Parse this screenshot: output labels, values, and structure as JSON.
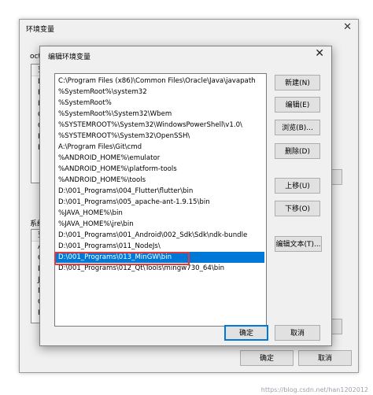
{
  "outer": {
    "title": "环境变量",
    "close": "✕",
    "user_section_label": "octo",
    "user_header": "变",
    "user_rows": [
      "De",
      "FL",
      "In",
      "O",
      "O",
      "Pa",
      "PU"
    ],
    "system_section_label": "系统",
    "system_header": "变",
    "system_rows": [
      "AI",
      "Cc",
      "Dr",
      "JA",
      "NI",
      "O",
      "Pa"
    ],
    "ok": "确定",
    "cancel": "取消"
  },
  "dialog": {
    "title": "编辑环境变量",
    "close": "✕",
    "paths": [
      "C:\\Program Files (x86)\\Common Files\\Oracle\\Java\\javapath",
      "%SystemRoot%\\system32",
      "%SystemRoot%",
      "%SystemRoot%\\System32\\Wbem",
      "%SYSTEMROOT%\\System32\\WindowsPowerShell\\v1.0\\",
      "%SYSTEMROOT%\\System32\\OpenSSH\\",
      "A:\\Program Files\\Git\\cmd",
      "%ANDROID_HOME%\\emulator",
      "%ANDROID_HOME%\\platform-tools",
      "%ANDROID_HOME%\\tools",
      "D:\\001_Programs\\004_Flutter\\flutter\\bin",
      "D:\\001_Programs\\005_apache-ant-1.9.15\\bin",
      "%JAVA_HOME%\\bin",
      "%JAVA_HOME%\\jre\\bin",
      "D:\\001_Programs\\001_Android\\002_Sdk\\Sdk\\ndk-bundle",
      "D:\\001_Programs\\011_NodeJs\\",
      "D:\\001_Programs\\013_MinGW\\bin",
      "D:\\001_Programs\\012_Qt\\Tools\\mingw730_64\\bin"
    ],
    "selected_index": 16,
    "buttons": {
      "new": "新建(N)",
      "edit": "编辑(E)",
      "browse": "浏览(B)...",
      "delete": "删除(D)",
      "move_up": "上移(U)",
      "move_down": "下移(O)",
      "edit_text": "编辑文本(T)..."
    },
    "ok": "确定",
    "cancel": "取消"
  },
  "watermark": "https://blog.csdn.net/han1202012",
  "colors": {
    "selection": "#0078d7",
    "highlight_box": "#e03a3a"
  }
}
